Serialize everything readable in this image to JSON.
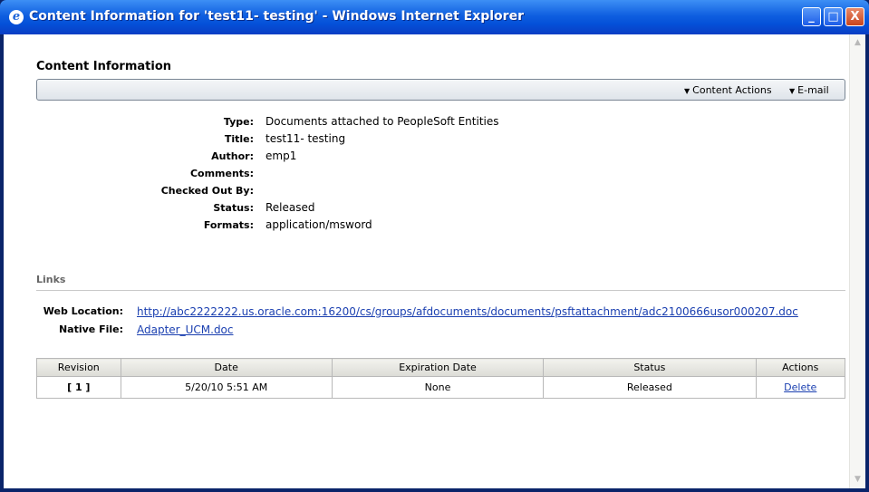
{
  "window": {
    "title": "Content Information for 'test11- testing' - Windows Internet Explorer",
    "minimize": "_",
    "maximize": "□",
    "close": "X"
  },
  "page": {
    "heading": "Content Information",
    "actions": {
      "content_actions": "Content Actions",
      "email": "E-mail"
    }
  },
  "info": {
    "rows": [
      {
        "label": "Type:",
        "value": "Documents attached to PeopleSoft Entities"
      },
      {
        "label": "Title:",
        "value": "test11- testing"
      },
      {
        "label": "Author:",
        "value": "emp1"
      },
      {
        "label": "Comments:",
        "value": ""
      },
      {
        "label": "Checked Out By:",
        "value": ""
      },
      {
        "label": "Status:",
        "value": "Released"
      },
      {
        "label": "Formats:",
        "value": "application/msword"
      }
    ]
  },
  "links": {
    "heading": "Links",
    "web_location_label": "Web Location:",
    "web_location_url": "http://abc2222222.us.oracle.com:16200/cs/groups/afdocuments/documents/psftattachment/adc2100666usor000207.doc",
    "native_file_label": "Native File:",
    "native_file": "Adapter_UCM.doc"
  },
  "revisions": {
    "headers": [
      "Revision",
      "Date",
      "Expiration Date",
      "Status",
      "Actions"
    ],
    "rows": [
      {
        "revision": "[ 1 ]",
        "date": "5/20/10 5:51 AM",
        "expiration": "None",
        "status": "Released",
        "action": "Delete"
      }
    ]
  },
  "colors": {
    "titlebar": "#0450d8",
    "link": "#1a3fb0"
  }
}
